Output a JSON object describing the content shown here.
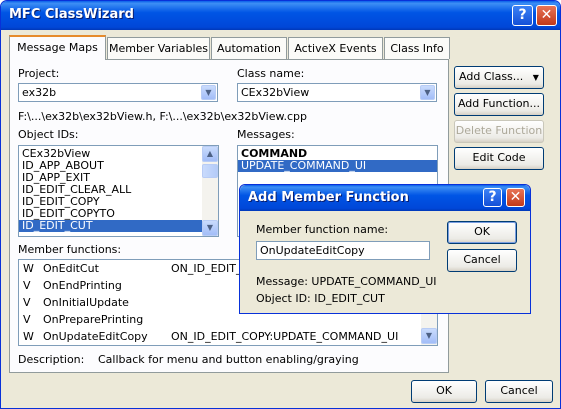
{
  "window": {
    "title": "MFC ClassWizard",
    "help_glyph": "?",
    "close_glyph": "✕"
  },
  "tabs": [
    "Message Maps",
    "Member Variables",
    "Automation",
    "ActiveX Events",
    "Class Info"
  ],
  "project": {
    "label": "Project:",
    "value": "ex32b"
  },
  "class_name": {
    "label": "Class name:",
    "value": "CEx32bView"
  },
  "file_path": "F:\\...\\ex32b\\ex32bView.h, F:\\...\\ex32b\\ex32bView.cpp",
  "object_ids": {
    "label": "Object IDs:",
    "items": [
      "CEx32bView",
      "ID_APP_ABOUT",
      "ID_APP_EXIT",
      "ID_EDIT_CLEAR_ALL",
      "ID_EDIT_COPY",
      "ID_EDIT_COPYTO",
      "ID_EDIT_CUT"
    ],
    "selected": 6
  },
  "messages": {
    "label": "Messages:",
    "items": [
      "COMMAND",
      "UPDATE_COMMAND_UI"
    ],
    "selected": 1
  },
  "buttons": {
    "add_class": "Add Class...",
    "add_class_arrow": "▼",
    "add_function": "Add Function...",
    "delete_function": "Delete Function",
    "edit_code": "Edit Code"
  },
  "member_functions": {
    "label": "Member functions:",
    "rows": [
      {
        "flag": "W",
        "name": "OnEditCut",
        "map": "ON_ID_EDIT_C"
      },
      {
        "flag": "V",
        "name": "OnEndPrinting",
        "map": ""
      },
      {
        "flag": "V",
        "name": "OnInitialUpdate",
        "map": ""
      },
      {
        "flag": "V",
        "name": "OnPreparePrinting",
        "map": ""
      },
      {
        "flag": "W",
        "name": "OnUpdateEditCopy",
        "map": "ON_ID_EDIT_COPY:UPDATE_COMMAND_UI"
      }
    ]
  },
  "description": {
    "label": "Description:",
    "text": "Callback for menu and button enabling/graying"
  },
  "footer": {
    "ok": "OK",
    "cancel": "Cancel"
  },
  "add_member_dialog": {
    "title": "Add Member Function",
    "name_label": "Member function name:",
    "name_value": "OnUpdateEditCopy",
    "message_text": "Message: UPDATE_COMMAND_UI",
    "object_id_text": "Object ID: ID_EDIT_CUT",
    "ok": "OK",
    "cancel": "Cancel"
  },
  "colors": {
    "title_blue": "#0055E5",
    "selection": "#316AC5",
    "face": "#ECE9D8",
    "tab_accent": "#E68B2C"
  }
}
